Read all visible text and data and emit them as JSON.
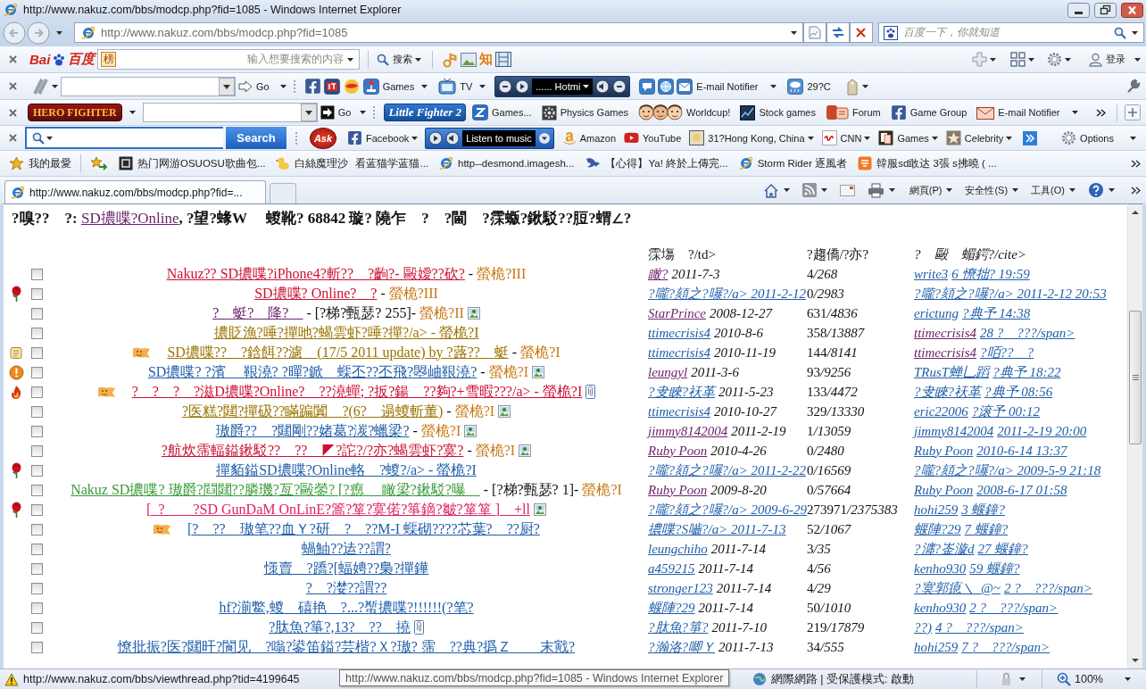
{
  "window": {
    "title": "http://www.nakuz.com/bbs/modcp.php?fid=1085 - Windows Internet Explorer"
  },
  "address_bar": {
    "url": "http://www.nakuz.com/bbs/modcp.php?fid=1085",
    "search_placeholder": "百度一下，你就知道"
  },
  "baidu_toolbar": {
    "logo": [
      "Bai",
      "百度"
    ],
    "badge": "榜",
    "search_placeholder": "输入想要搜索的内容",
    "search_button": "搜索",
    "knowledge_button": "知",
    "login": "登录"
  },
  "toolbar_2": {
    "go": "Go",
    "games": "Games",
    "tv": "TV",
    "player_display": "...... Hotmi",
    "email": "E-mail Notifier",
    "weather": "29?C"
  },
  "toolbar_3": {
    "logo": "HERO FIGHTER",
    "go": "Go",
    "lf2_logo": "Little Fighter 2",
    "links": [
      "Games...",
      "Physics Games",
      "Worldcup!",
      "Stock games",
      "Forum",
      "Game Group",
      "E-mail Notifier"
    ]
  },
  "toolbar_4": {
    "search_button": "Search",
    "ask_logo": "Ask",
    "facebook": "Facebook",
    "player_label": "Listen to music",
    "links": [
      "Amazon",
      "YouTube",
      "31?Hong Kong, China",
      "CNN",
      "Games",
      "Celebrity"
    ],
    "options": "Options"
  },
  "favorites_bar": {
    "title": "我的最愛",
    "items": [
      "热门网游OSUOSU歌曲包...",
      "白絲魔理沙",
      "看蓝猫学蓝猫...",
      "http--desmond.imagesh...",
      "【心得】Ya! 終於上傳完...",
      "Storm Rider 逐風者",
      "韓服sd敢达 3張 s拂曉 ( ..."
    ]
  },
  "tabs": [
    {
      "label": "http://www.nakuz.com/bbs/modcp.php?fid=...",
      "selected": true
    }
  ],
  "command_bar": {
    "menus": [
      "網頁(P)",
      "安全性(S)",
      "工具(O)"
    ]
  },
  "page": {
    "heading": {
      "prefix": "?嗅??　?: ",
      "forum_link": "SD擃喋?Online",
      "suffix": ", ?望?蝝W　 蝬靴? 68842 璇? 隢乍　?　?閫　?霂蝂?鍬駁??脰?蝟∠?"
    },
    "columns": [
      "霂塲　?/td>",
      "?趨僑/?亦?",
      "?　毆　蝞鍔?/cite>"
    ],
    "threads": [
      {
        "kind": "plain",
        "checked": false,
        "smiley": false,
        "title": "Nakuz?? SD擃喋?iPhone4?斬??　?齣?- 毆嬡??砍?",
        "color": "#cc1133",
        "tag": "-",
        "suffix": "螢桅?III",
        "image": false,
        "attachment": false,
        "author": {
          "name": "瞰?",
          "visited": true,
          "date": "2011-7-3"
        },
        "replies": "4",
        "views": "/268",
        "last": {
          "name": "write3",
          "visited": false,
          "time": "6 憭拙? 19:59"
        }
      },
      {
        "kind": "rose",
        "checked": false,
        "smiley": false,
        "title": "SD擃喋? Online?　?",
        "color": "#cc1133",
        "tag": "-",
        "suffix": "螢桅?III",
        "image": false,
        "attachment": false,
        "author": {
          "name": "?嚨?頦之?嚗?/a> 2011-2-12",
          "visited": false
        },
        "replies": "0",
        "views": "/2983",
        "last": {
          "name": "?嚨?頦之?嚗?/a> 2011-2-12 20:53",
          "visited": false
        }
      },
      {
        "kind": "plain",
        "checked": false,
        "smiley": false,
        "title": "?　蜓?　降?　",
        "color": "#6c246c",
        "tag": "- [?梯?甄瑟? 255]-",
        "suffix": "螢桅?II",
        "image": true,
        "attachment": false,
        "author": {
          "name": "StarPrince",
          "visited": true,
          "date": "2008-12-27"
        },
        "replies": "631",
        "views": "/4836",
        "last": {
          "name": "erictung",
          "visited": false,
          "time": "?典予 14:38"
        }
      },
      {
        "kind": "plain",
        "checked": false,
        "smiley": false,
        "title": "擃貶漁?唾?撣吔?蝎雲虾?唾?撣?/a> - 螢桅?I",
        "color": "#9a7400",
        "image": false,
        "attachment": false,
        "author": {
          "name": "ttimecrisis4",
          "visited": false,
          "date": "2010-8-6"
        },
        "replies": "358",
        "views": "/13887",
        "last": {
          "name": "ttimecrisis4",
          "visited": true,
          "time": "28 ?　???/span>"
        }
      },
      {
        "kind": "scroll",
        "checked": false,
        "smiley": true,
        "title": "SD擃喋??　?鋡餌??濾　(17/5 2011 update) by ?蕗??　蜓",
        "color": "#9a7400",
        "tag": "-",
        "suffix": "螢桅?I",
        "image": false,
        "attachment": false,
        "author": {
          "name": "ttimecrisis4",
          "visited": false,
          "date": "2010-11-19"
        },
        "replies": "144",
        "views": "/8141",
        "last": {
          "name": "ttimecrisis4",
          "visited": true,
          "time": "?咟??　?"
        }
      },
      {
        "kind": "alert",
        "checked": false,
        "smiley": false,
        "title": "SD擃喋? ?濱　 鞎澆? ?暺?鍁　蟝丕??丕飛?曌岫鞎澆?",
        "color": "#1f5ea8",
        "tag": "-",
        "suffix": "螢桅?I",
        "image": true,
        "attachment": false,
        "author": {
          "name": "leungyl",
          "visited": true,
          "date": "2011-3-6"
        },
        "replies": "93",
        "views": "/9256",
        "last": {
          "name": "TRusT蝉乚蹈",
          "visited": false,
          "time": "?典予 18:22"
        }
      },
      {
        "kind": "fire",
        "checked": false,
        "smiley": true,
        "title": "?　?　?　?滋D擃喋?Online?　??澆蟬; ?扳?鍚　??夠?+雪暇???/a> - 螢桅?I",
        "color": "#cc1133",
        "image": false,
        "attachment": true,
        "author": {
          "name": "?叏睞?祆革",
          "visited": false,
          "date": "2011-5-23"
        },
        "replies": "133",
        "views": "/4472",
        "last": {
          "name": "?叏睞?祆革",
          "visited": false,
          "time": "?典予 08:56"
        }
      },
      {
        "kind": "plain",
        "checked": false,
        "smiley": false,
        "title": "?医糕?閮?撣砐??瞞蹁闐　?(6?　遢蝬斬董)",
        "color": "#9a7400",
        "tag": "-",
        "suffix": "螢桅?I",
        "image": true,
        "attachment": false,
        "author": {
          "name": "ttimecrisis4",
          "visited": false,
          "date": "2010-10-27"
        },
        "replies": "329",
        "views": "/13330",
        "last": {
          "name": "eric22006",
          "visited": false,
          "time": "?滚予 00:12"
        }
      },
      {
        "kind": "plain",
        "checked": false,
        "smiley": false,
        "title": "璈爵??　?閮剛??媎葛?湠?蠟梁?",
        "color": "#1f5ea8",
        "tag": "-",
        "suffix": "螢桅?I",
        "image": true,
        "attachment": false,
        "author": {
          "name": "jimmy8142004",
          "visited": true,
          "date": "2011-2-19"
        },
        "replies": "1",
        "views": "/13059",
        "last": {
          "name": "jimmy8142004",
          "visited": false,
          "time": "2011-2-19 20:00"
        }
      },
      {
        "kind": "plain",
        "checked": false,
        "smiley": false,
        "title": "?航炊霈輻鎰鍬駁??　??　◤?詑?/?亦?蝎雲虾?寞?",
        "color": "#cc1133",
        "tag": "-",
        "suffix": "螢桅?I",
        "image": true,
        "attachment": false,
        "author": {
          "name": "Ruby Poon",
          "visited": true,
          "date": "2010-4-26"
        },
        "replies": "0",
        "views": "/2480",
        "last": {
          "name": "Ruby Poon",
          "visited": false,
          "time": "2010-6-14 13:37"
        }
      },
      {
        "kind": "rose",
        "checked": false,
        "smiley": false,
        "title": "撣貊鎰SD擃喋?Online輅　?蝬?/a> - 螢桅?I",
        "color": "#1f5ea8",
        "image": false,
        "attachment": false,
        "author": {
          "name": "?嚨?頦之?嚗?/a> 2011-2-22",
          "visited": false
        },
        "replies": "0",
        "views": "/16569",
        "last": {
          "name": "?嚨?頦之?嚗?/a> 2009-5-9 21:18",
          "visited": false
        }
      },
      {
        "kind": "plain",
        "checked": false,
        "smiley": false,
        "title": "Nakuz SD擃喋? 璈爵?閰閮??膦璣?亙?毆鎣? [?瘛　 瞰梁?鍬駁?曝　",
        "color": "#3a9a3a",
        "tag": "- [?梯?甄瑟? 1]-",
        "suffix": "螢桅?I",
        "image": false,
        "attachment": false,
        "author": {
          "name": "Ruby Poon",
          "visited": true,
          "date": "2009-8-20"
        },
        "replies": "0",
        "views": "/57664",
        "last": {
          "name": "Ruby Poon",
          "visited": false,
          "time": "2008-6-17 01:58"
        }
      },
      {
        "kind": "rose",
        "checked": false,
        "smiley": false,
        "title": "[_?　　?SD GunDaM OnLinE?篙?箪?寞偌?箏鏑?皺?箪箪 ]__+ll",
        "color": "#dd2266",
        "image": true,
        "attachment": false,
        "author": {
          "name": "?嚨?頦之?嚗?/a> 2009-6-29",
          "visited": false
        },
        "replies": "273971",
        "views": "/2375383",
        "last": {
          "name": "hohi259",
          "visited": false,
          "time": "3 蝘鐘?"
        }
      },
      {
        "kind": "plain",
        "checked": false,
        "smiley": true,
        "title": "[?　??　璈笔??血Ｙ?研　?　??M-I 蟝砌????芯葉?　??厨?",
        "color": "#1f5ea8",
        "image": false,
        "attachment": false,
        "author": {
          "name": "擃喋?S嚙?/a> 2011-7-13",
          "visited": false
        },
        "replies": "52",
        "views": "/1067",
        "last": {
          "name": "蝘陣?29",
          "visited": false,
          "time": "7 蝘鐘?"
        }
      },
      {
        "kind": "plain",
        "checked": false,
        "smiley": false,
        "title": "蝸鮋??迲??謂?",
        "color": "#1f5ea8",
        "image": false,
        "attachment": false,
        "author": {
          "name": "leungchiho",
          "visited": false,
          "date": "2011-7-14"
        },
        "replies": "3",
        "views": "/35",
        "last": {
          "name": "?瀍?崟漩d",
          "visited": false,
          "time": "27 蝘鐘?"
        }
      },
      {
        "kind": "plain",
        "checked": false,
        "smiley": false,
        "title": "憡賣　?蹻?[蝠娉??梟?撣鏵",
        "color": "#1f5ea8",
        "image": false,
        "attachment": false,
        "author": {
          "name": "a459215",
          "visited": false,
          "date": "2011-7-14"
        },
        "replies": "4",
        "views": "/56",
        "last": {
          "name": "kenho930",
          "visited": false,
          "time": "59 蝘鐘?"
        }
      },
      {
        "kind": "plain",
        "checked": false,
        "smiley": false,
        "title": "?　?漤??謂??",
        "color": "#1f5ea8",
        "image": false,
        "attachment": false,
        "author": {
          "name": "stronger123",
          "visited": false,
          "date": "2011-7-14"
        },
        "replies": "4",
        "views": "/29",
        "last": {
          "name": "?寞郭瘜＼_@~",
          "visited": false,
          "time": "2 ?　???/span>"
        }
      },
      {
        "kind": "plain",
        "checked": false,
        "smiley": false,
        "title": "hf?湔鱉,蝬　礂艳　?...?蟴擃喋?!!!!!!(?笔?",
        "color": "#1f5ea8",
        "image": false,
        "attachment": false,
        "author": {
          "name": "蝘陣?29",
          "visited": false,
          "date": "2011-7-14"
        },
        "replies": "50",
        "views": "/1010",
        "last": {
          "name": "kenho930",
          "visited": false,
          "time": "2 ?　???/span>"
        }
      },
      {
        "kind": "plain",
        "checked": false,
        "smiley": false,
        "title": "?肽魚?箏?,13?　??　撓",
        "color": "#1f5ea8",
        "image": false,
        "attachment": true,
        "author": {
          "name": "?肽魚?箏?",
          "visited": false,
          "date": "2011-7-10"
        },
        "replies": "219",
        "views": "/17879",
        "last": {
          "name": "??)",
          "visited": false,
          "time": "4 ?　???/span>"
        }
      },
      {
        "kind": "plain",
        "checked": false,
        "smiley": false,
        "title": "憭批振?医?閮旰?閬见　?嗡?鍙笛鎰?芸楷?Ｘ?璈? 霈　??典?撝Ｚ　　末戭?",
        "color": "#1f5ea8",
        "image": false,
        "attachment": false,
        "author": {
          "name": "?瀚洛?唧Ｙ",
          "visited": false,
          "date": "2011-7-13"
        },
        "replies": "34",
        "views": "/555",
        "last": {
          "name": "hohi259",
          "visited": false,
          "time": "7 ?　???/span>"
        }
      }
    ]
  },
  "status_bar": {
    "url": "http://www.nakuz.com/bbs/viewthread.php?tid=4199645",
    "tooltip": "http://www.nakuz.com/bbs/modcp.php?fid=1085 - Windows Internet Explorer",
    "zone": "網際網路 | 受保護模式: 啟動",
    "zoom": "100%"
  }
}
